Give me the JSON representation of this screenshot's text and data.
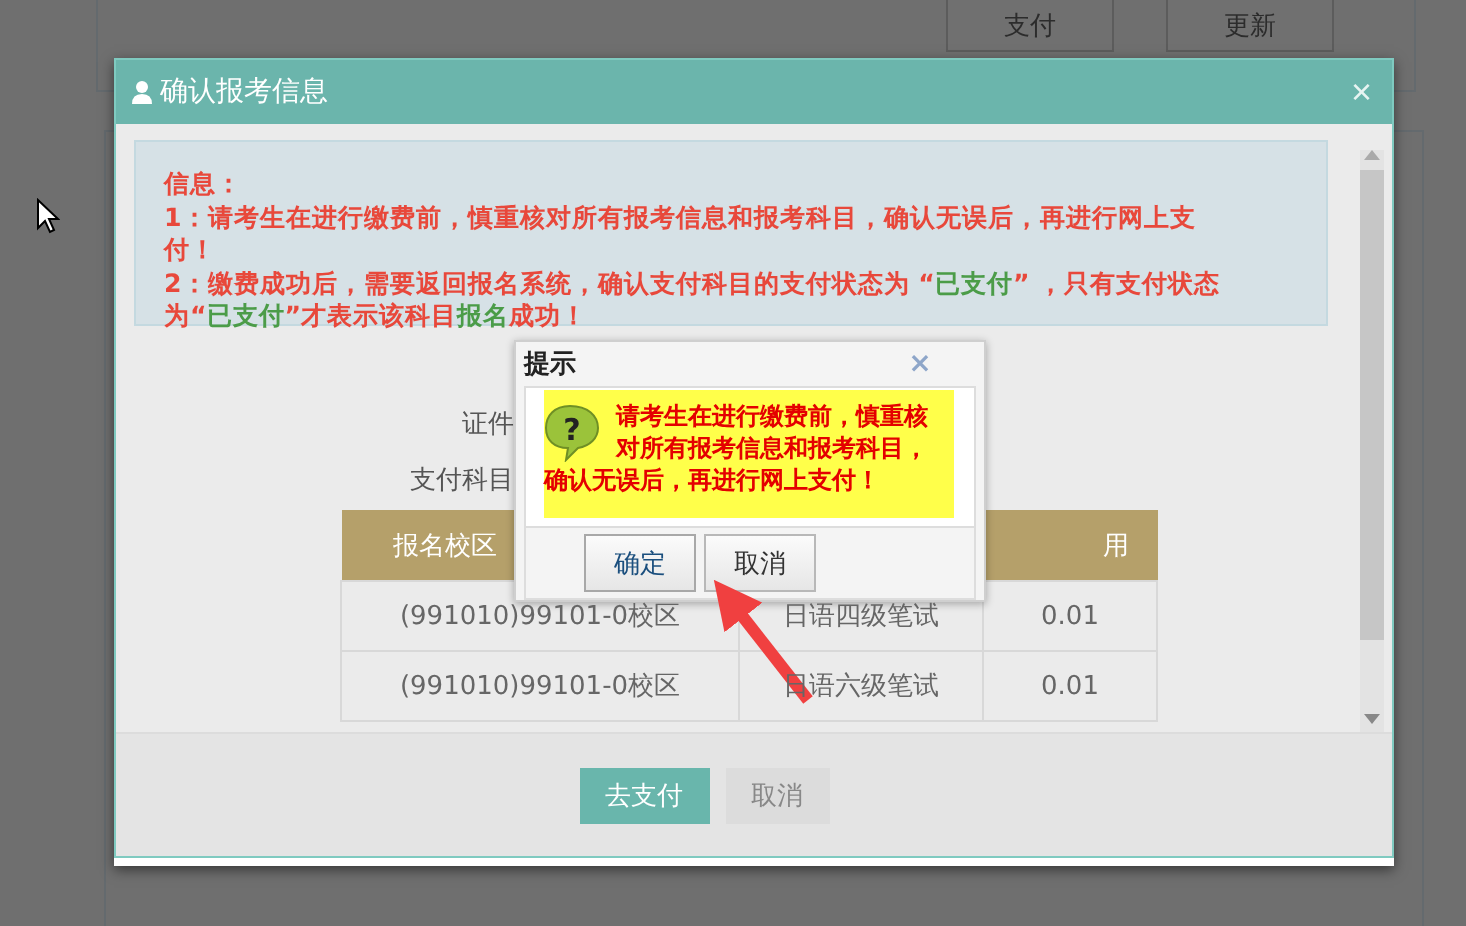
{
  "background": {
    "buttons": [
      "支付",
      "更新"
    ]
  },
  "modal": {
    "title": "确认报考信息",
    "close": "×",
    "info": {
      "heading": "信息：",
      "lines": [
        [
          {
            "kind": "red",
            "text": "1：请考生在进行缴费前，慎重核对所有报考信息和报考科目，确认无误后，再进行网上支付！"
          }
        ],
        [
          {
            "kind": "red",
            "text": "2：缴费成功后，需要返回报名系统，确认支付科目的支付状态为 “"
          },
          {
            "kind": "green",
            "text": "已支付"
          },
          {
            "kind": "red",
            "text": "” ，只有支付状态为“"
          },
          {
            "kind": "green",
            "text": "已支付"
          },
          {
            "kind": "red",
            "text": "”才表示该科目"
          },
          {
            "kind": "green",
            "text": "报名"
          },
          {
            "kind": "red",
            "text": "成功！"
          }
        ]
      ]
    },
    "fields": [
      "证件",
      "支付科目"
    ],
    "table": {
      "column_1": "报名校区",
      "column_3": "用",
      "rows": [
        [
          "(991010)99101-0校区",
          "日语四级笔试",
          "0.01"
        ],
        [
          "(991010)99101-0校区",
          "日语六级笔试",
          "0.01"
        ]
      ]
    },
    "buttons": [
      {
        "label": "去支付",
        "kind": "primary"
      },
      {
        "label": "取消",
        "kind": "secondary"
      }
    ]
  },
  "prompt": {
    "title": "提示",
    "close": "×",
    "icon": "?",
    "message": "请考生在进行缴费前，慎重核对所有报考信息和报考科目，确认无误后，再进行网上支付！",
    "buttons": [
      {
        "label": "确定",
        "selected": true
      },
      {
        "label": "取消",
        "selected": false
      }
    ]
  }
}
